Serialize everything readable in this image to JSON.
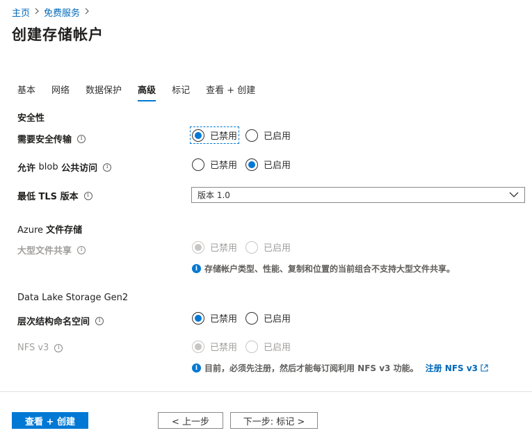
{
  "breadcrumb": {
    "items": [
      "主页",
      "免费服务"
    ],
    "separator": ">"
  },
  "page": {
    "title": "创建存储帐户"
  },
  "tabs": [
    {
      "label": "基本",
      "active": false
    },
    {
      "label": "网络",
      "active": false
    },
    {
      "label": "数据保护",
      "active": false
    },
    {
      "label": "高级",
      "active": true
    },
    {
      "label": "标记",
      "active": false
    },
    {
      "label": "查看 + 创建",
      "active": false
    }
  ],
  "security": {
    "title": "安全性",
    "secure_transfer": {
      "label": "需要安全传输",
      "options": [
        "已禁用",
        "已启用"
      ],
      "selected": "已禁用"
    },
    "blob_public": {
      "label_prefix": "允许",
      "label_blob": "blob",
      "label_suffix": "公共访问",
      "options": [
        "已禁用",
        "已启用"
      ],
      "selected": "已启用"
    },
    "tls": {
      "label": "最低 TLS 版本",
      "value": "版本 1.0"
    }
  },
  "azure_files": {
    "title_prefix": "Azure",
    "title_suffix": "文件存储",
    "large_share": {
      "label": "大型文件共享",
      "options": [
        "已禁用",
        "已启用"
      ],
      "selected": "已禁用",
      "disabled": true
    },
    "note": "存储帐户类型、性能、复制和位置的当前组合不支持大型文件共享。"
  },
  "data_lake": {
    "title": "Data Lake Storage Gen2",
    "hns": {
      "label": "层次结构命名空间",
      "options": [
        "已禁用",
        "已启用"
      ],
      "selected": "已禁用"
    },
    "nfs": {
      "label": "NFS v3",
      "options": [
        "已禁用",
        "已启用"
      ],
      "selected": "已禁用",
      "disabled": true
    },
    "note": "目前，必须先注册，然后才能每订阅利用 NFS v3 功能。",
    "note_link": "注册 NFS v3"
  },
  "footer": {
    "review_create": "查看 + 创建",
    "prev": "< 上一步",
    "next": "下一步: 标记 >"
  },
  "colors": {
    "accent": "#0078d4",
    "link": "#0067b8"
  },
  "icons": {
    "info": "info-icon",
    "external": "external-link-icon",
    "chevron": "chevron-down-icon"
  }
}
